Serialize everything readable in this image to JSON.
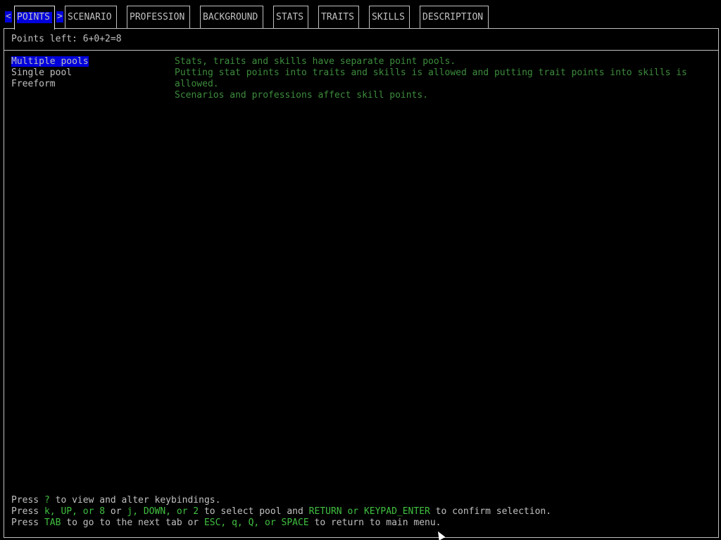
{
  "tabs": {
    "prev_arrow": "<",
    "next_arrow": ">",
    "items": [
      {
        "label": "POINTS"
      },
      {
        "label": "SCENARIO"
      },
      {
        "label": "PROFESSION"
      },
      {
        "label": "BACKGROUND"
      },
      {
        "label": "STATS"
      },
      {
        "label": "TRAITS"
      },
      {
        "label": "SKILLS"
      },
      {
        "label": "DESCRIPTION"
      }
    ],
    "active": "POINTS"
  },
  "points_left": "Points left: 6+0+2=8",
  "pools": {
    "items": [
      {
        "label": "Multiple pools"
      },
      {
        "label": "Single pool"
      },
      {
        "label": "Freeform"
      }
    ],
    "selected": "Multiple pools"
  },
  "description": {
    "lines": [
      "Stats, traits and skills have separate point pools.",
      "Putting stat points into traits and skills is allowed and putting trait points into skills is allowed.",
      "Scenarios and professions affect skill points."
    ]
  },
  "help": {
    "line1": {
      "a": "Press ",
      "k1": "?",
      "b": " to view and alter keybindings."
    },
    "line2": {
      "a": "Press ",
      "k1": "k, UP, or 8",
      "b": " or ",
      "k2": "j, DOWN, or 2",
      "c": " to select pool and ",
      "k3": "RETURN or KEYPAD_ENTER",
      "d": " to confirm selection."
    },
    "line3": {
      "a": "Press ",
      "k1": "TAB",
      "b": " to go to the next tab or ",
      "k2": "ESC, q, Q, or SPACE",
      "c": " to return to main menu."
    }
  },
  "colors": {
    "background": "#000000",
    "text": "#c0c0c0",
    "highlight": "#0000dc",
    "description": "#3c8c3c",
    "keys": "#40c040"
  }
}
